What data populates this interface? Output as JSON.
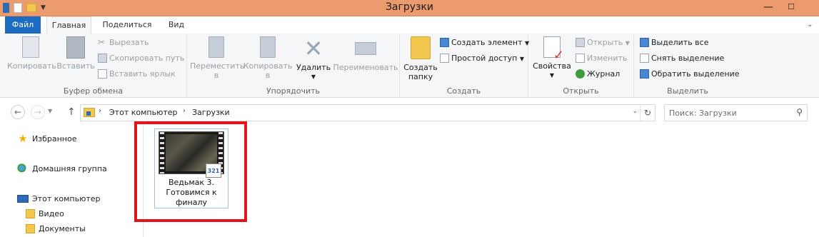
{
  "window": {
    "title": "Загрузки",
    "controls": {
      "minimize": "—",
      "maximize": "☐"
    }
  },
  "ribbon_tabs": [
    "Файл",
    "Главная",
    "Поделиться",
    "Вид"
  ],
  "ribbon": {
    "clipboard": {
      "label": "Буфер обмена",
      "copy": "Копировать",
      "paste": "Вставить",
      "cut": "Вырезать",
      "copy_path": "Скопировать путь",
      "paste_shortcut": "Вставить ярлык"
    },
    "organize": {
      "label": "Упорядочить",
      "move_to": [
        "Переместить",
        "в"
      ],
      "copy_to": [
        "Копировать",
        "в"
      ],
      "delete": "Удалить",
      "rename": "Переименовать"
    },
    "new": {
      "label": "Создать",
      "new_folder": [
        "Создать",
        "папку"
      ],
      "new_item": "Создать элемент",
      "easy_access": "Простой доступ"
    },
    "open": {
      "label": "Открыть",
      "properties": "Свойства",
      "open": "Открыть",
      "edit": "Изменить",
      "history": "Журнал"
    },
    "select": {
      "label": "Выделить",
      "select_all": "Выделить все",
      "select_none": "Снять выделение",
      "invert_selection": "Обратить выделение"
    }
  },
  "address": {
    "segments": [
      "Этот компьютер",
      "Загрузки"
    ]
  },
  "search": {
    "placeholder": "Поиск: Загрузки"
  },
  "nav_pane": {
    "items": [
      "Избранное",
      "Домашняя группа",
      "Этот компьютер",
      "Видео",
      "Документы"
    ]
  },
  "files": [
    {
      "name": "Ведьмак 3. Готовимся к финалу",
      "badge": "321",
      "selected": true
    }
  ],
  "colors": {
    "titlebar": "#eb9b6e",
    "file_tab": "#1b6bc3",
    "highlight_box": "#e3131c"
  }
}
